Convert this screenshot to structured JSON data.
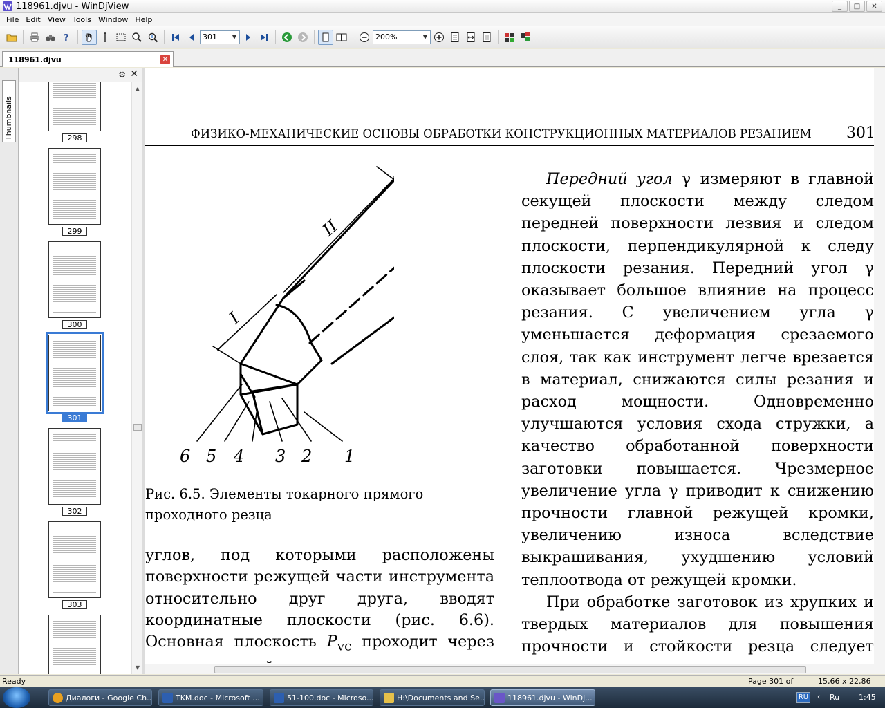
{
  "window": {
    "title": "118961.djvu - WinDjView",
    "controls": [
      "_",
      "□",
      "✕"
    ]
  },
  "menu": [
    "File",
    "Edit",
    "View",
    "Tools",
    "Window",
    "Help"
  ],
  "toolbar": {
    "page_value": "301",
    "zoom_value": "200%"
  },
  "tab": {
    "name": "118961.djvu",
    "close": "✕"
  },
  "sidebar": {
    "tab_label": "Thumbnails",
    "thumbnails": [
      {
        "page": "298",
        "selected": false
      },
      {
        "page": "299",
        "selected": false
      },
      {
        "page": "300",
        "selected": false
      },
      {
        "page": "301",
        "selected": true
      },
      {
        "page": "302",
        "selected": false
      },
      {
        "page": "303",
        "selected": false
      }
    ]
  },
  "document": {
    "running_head": "ФИЗИКО-МЕХАНИЧЕСКИЕ ОСНОВЫ ОБРАБОТКИ КОНСТРУКЦИОННЫХ МАТЕРИАЛОВ РЕЗАНИЕМ",
    "page_number": "301",
    "right_column": {
      "p1_em": "Передний угол",
      "p1_rest": " γ измеряют в главной секущей плоскости между следом передней поверхности лезвия и следом плоскости, перпендикулярной к следу плоскости резания. Передний угол γ оказывает большое влияние на процесс резания. С увеличением угла γ уменьшается деформация срезаемого слоя, так как инструмент легче врезается в материал, снижаются силы резания и расход мощности. Одновременно улучшаются условия схода стружки, а качество обработанной поверхности заготовки повышается. Чрезмерное увеличение угла γ приводит к снижению прочности главной режущей кромки, увеличению износа вследствие выкрашивания, ухудшению условий теплоотвода от режущей кромки.",
      "p2": "При обработке заготовок из хрупких и твердых материалов для повышения прочности и стойкости резца следует назначать меньшие значения угла γ, иногда – отри-"
    },
    "figure": {
      "labels": [
        "6",
        "5",
        "4",
        "3",
        "2",
        "1"
      ],
      "dim_labels": [
        "I",
        "II"
      ]
    },
    "caption_line1": "Рис. 6.5. Элементы токарного прямого",
    "caption_line2": "проходного резца",
    "left_column": {
      "text_a": "углов, под которыми расположены поверхности режущей части инструмента относительно друг друга, вводят координатные плоскости (рис. 6.6). Основная плоскость ",
      "sym": "P",
      "sub": "vc",
      "text_b": " проходит через точку режущей кромки перпендикулярно к направле-"
    }
  },
  "status": {
    "ready": "Ready",
    "page_info": "Page 301 of 512",
    "size_info": "15,66 x 22,86 cm"
  },
  "taskbar": {
    "items": [
      {
        "label": "Диалоги - Google Ch...",
        "color": "#e8a020"
      },
      {
        "label": "TKM.doc - Microsoft ...",
        "color": "#2d5fb0"
      },
      {
        "label": "51-100.doc - Microso...",
        "color": "#2d5fb0"
      },
      {
        "label": "H:\\Documents and Se...",
        "color": "#e5c04a"
      },
      {
        "label": "118961.djvu - WinDj...",
        "color": "#6a56c8"
      }
    ],
    "lang": "RU",
    "keyboard": "Ru",
    "clock": "1:45"
  }
}
